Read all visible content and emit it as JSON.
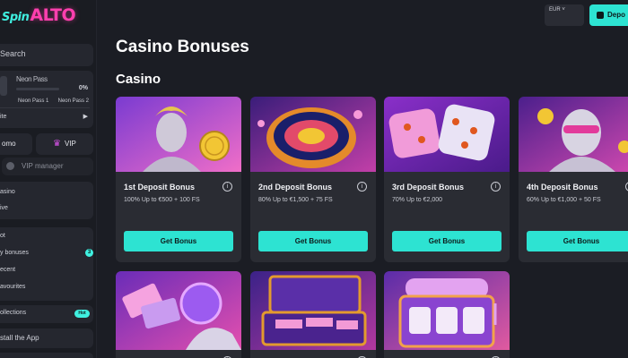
{
  "brand": {
    "logo_spin": "Spin",
    "logo_alto": "ALTO"
  },
  "sidebar": {
    "search_label": "Search",
    "pass": {
      "name": "Neon Pass",
      "progress_pct": "0%",
      "progress_fraction": 0,
      "level_from": "Neon Pass 1",
      "level_to": "Neon Pass 2",
      "row_label": "ite"
    },
    "promo_label": "omo",
    "vip_label": "VIP",
    "vip_manager_label": "VIP manager",
    "nav_group1": [
      "asino",
      "ive"
    ],
    "nav_group2": [
      "ot",
      "y bonuses",
      "ecent",
      "avourites"
    ],
    "my_bonuses_count": "3",
    "collections_label": "ollections",
    "collections_badge": "Hot",
    "install_label": "stall the App"
  },
  "header": {
    "currency": "EUR",
    "balance": "",
    "deposit_label": "Depo"
  },
  "main": {
    "page_title": "Casino Bonuses",
    "section_title": "Casino",
    "cards": [
      {
        "title": "1st Deposit Bonus",
        "desc": "100% Up to €500 + 100 FS",
        "button": "Get Bonus",
        "info": "i"
      },
      {
        "title": "2nd Deposit Bonus",
        "desc": "80% Up to €1,500 + 75 FS",
        "button": "Get Bonus",
        "info": "i"
      },
      {
        "title": "3rd Deposit Bonus",
        "desc": "70% Up to €2,000",
        "button": "Get Bonus",
        "info": "i"
      },
      {
        "title": "4th Deposit Bonus",
        "desc": "60% Up to €1,000 + 50 FS",
        "button": "Get Bonus",
        "info": "i"
      }
    ],
    "row2_info": [
      "i",
      "i",
      "i"
    ]
  },
  "colors": {
    "accent": "#2de3d2",
    "brand_pink": "#ff3fae",
    "background": "#1b1d24",
    "card": "#2a2c33"
  }
}
